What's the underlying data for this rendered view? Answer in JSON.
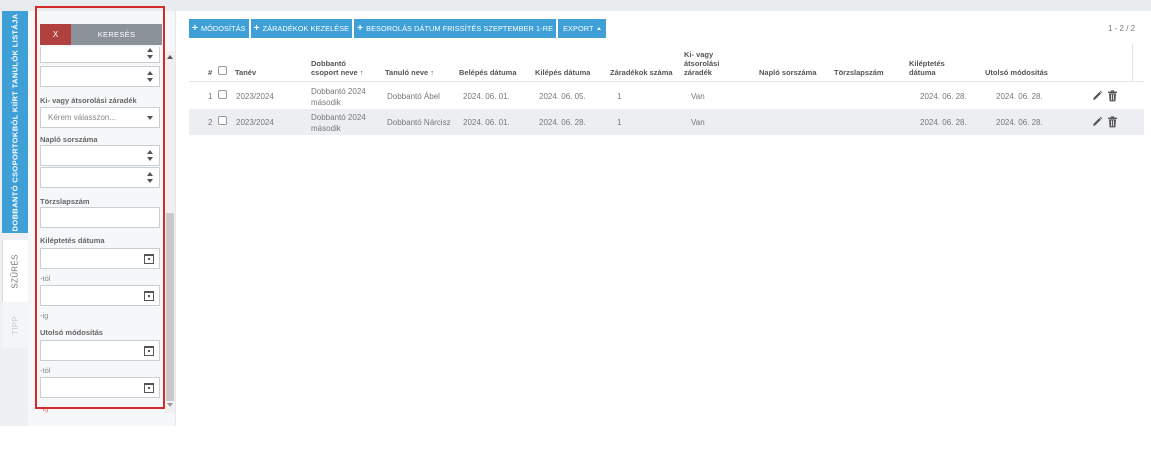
{
  "rail": {
    "main_tab": "DOBBANTÓ CSOPORTOKBÓL KIÍRT TANULÓK LISTÁJA",
    "filter_tab": "SZŰRÉS",
    "tip_tab": "TIPP"
  },
  "filter": {
    "clear_label": "X",
    "search_label": "KERESÉS",
    "clause_label": "Ki- vagy átsorolási záradék",
    "clause_placeholder": "Kérem válasszon...",
    "journal_label": "Napló sorszáma",
    "register_label": "Törzslapszám",
    "exit_date_label": "Kiléptetés dátuma",
    "from_label": "-tól",
    "to_label": "-ig",
    "last_mod_label": "Utolsó módosítás",
    "from_label_2": "-tól",
    "to_label_2": "-ig"
  },
  "toolbar": {
    "modify": "MÓDOSÍTÁS",
    "clauses": "ZÁRADÉKOK KEZELÉSE",
    "refresh_date": "BESOROLÁS DÁTUM FRISSÍTÉS SZEPTEMBER 1-RE",
    "export": "EXPORT"
  },
  "pager": "1 - 2 / 2",
  "columns": {
    "num": "#",
    "year": "Tanév",
    "group": "Dobbantó csoport neve",
    "student": "Tanuló neve",
    "entry": "Belépés dátuma",
    "exit": "Kilépés dátuma",
    "clause_count": "Záradékok száma",
    "clause": "Ki- vagy átsorolási záradék",
    "journal": "Napló sorszáma",
    "register": "Törzslapszám",
    "leave_date": "Kiléptetés dátuma",
    "last_mod": "Utolsó módosítás"
  },
  "rows": [
    {
      "num": "1",
      "year": "2023/2024",
      "group": "Dobbantó 2024 második",
      "student": "Dobbantó Ábel",
      "entry": "2024. 06. 01.",
      "exit": "2024. 06. 05.",
      "clause_count": "1",
      "clause": "Van",
      "journal": "",
      "register": "",
      "leave_date": "2024. 06. 28.",
      "last_mod": "2024. 06. 28."
    },
    {
      "num": "2",
      "year": "2023/2024",
      "group": "Dobbantó 2024 második",
      "student": "Dobbantó Nárcisz",
      "entry": "2024. 06. 01.",
      "exit": "2024. 06. 28.",
      "clause_count": "1",
      "clause": "Van",
      "journal": "",
      "register": "",
      "leave_date": "2024. 06. 28.",
      "last_mod": "2024. 06. 28."
    }
  ],
  "colors": {
    "primary": "#3ea0d7",
    "danger": "#b0413e",
    "highlight": "#d22b2b"
  }
}
